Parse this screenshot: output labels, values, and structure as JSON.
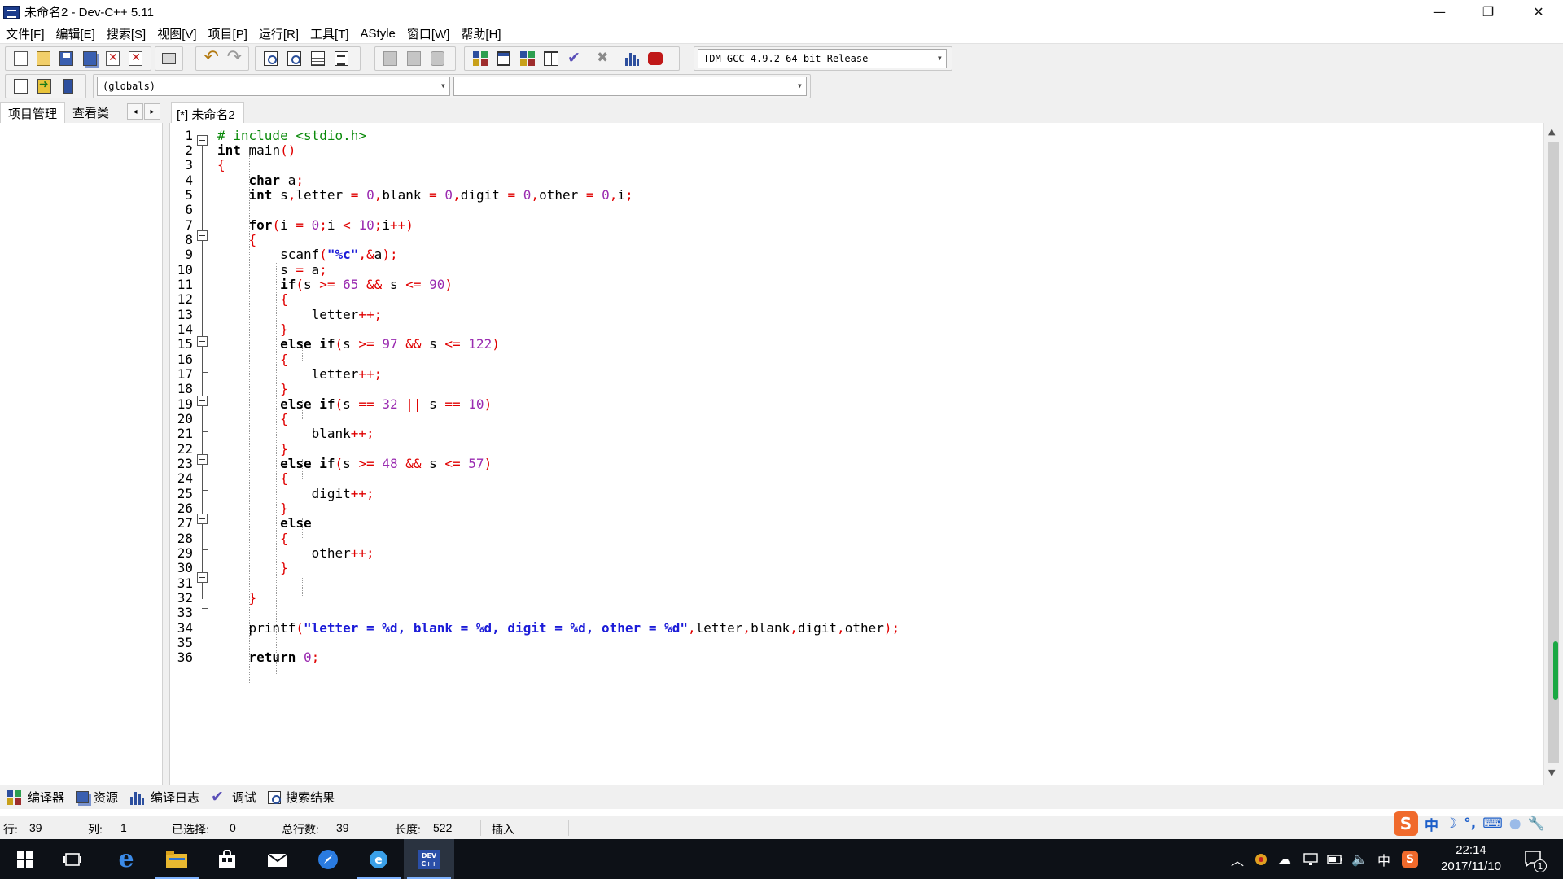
{
  "window": {
    "title": "未命名2 - Dev-C++ 5.11",
    "controls": [
      "—",
      "❐",
      "✕"
    ]
  },
  "menu": [
    "文件[F]",
    "编辑[E]",
    "搜索[S]",
    "视图[V]",
    "项目[P]",
    "运行[R]",
    "工具[T]",
    "AStyle",
    "窗口[W]",
    "帮助[H]"
  ],
  "toolbar": {
    "compiler_select": "TDM-GCC 4.9.2 64-bit Release",
    "scope_select": "(globals)",
    "function_select": ""
  },
  "left_panel": {
    "tabs": [
      "项目管理",
      "查看类"
    ],
    "prev_arrow": "◂",
    "next_arrow": "▸"
  },
  "editor": {
    "tab_label": "[*] 未命名2",
    "line_numbers": [
      "1",
      "2",
      "3",
      "4",
      "5",
      "6",
      "7",
      "8",
      "9",
      "10",
      "11",
      "12",
      "13",
      "14",
      "15",
      "16",
      "17",
      "18",
      "19",
      "20",
      "21",
      "22",
      "23",
      "24",
      "25",
      "26",
      "27",
      "28",
      "29",
      "30",
      "31",
      "32",
      "33",
      "34",
      "35",
      "36"
    ]
  },
  "bottom_tabs": [
    "编译器",
    "资源",
    "编译日志",
    "调试",
    "搜索结果"
  ],
  "status": {
    "row_label": "行:",
    "row_value": "39",
    "col_label": "列:",
    "col_value": "1",
    "selected_label": "已选择:",
    "selected_value": "0",
    "total_lines_label": "总行数:",
    "total_lines_value": "39",
    "length_label": "长度:",
    "length_value": "522",
    "mode": "插入"
  },
  "ime": {
    "lang": "中",
    "moon": "☽",
    "punct": "°,",
    "keyboard": "⌨",
    "person": "●",
    "wrench": "🔧"
  },
  "taskbar": {
    "time": "22:14",
    "date": "2017/11/10",
    "tray_lang": "中",
    "notification_count": "1"
  },
  "colors": {
    "keyword": "#000000",
    "operator": "#e00000",
    "number": "#9a2bb0",
    "string": "#1c1cd8",
    "preprocessor": "#0a8a0a"
  }
}
